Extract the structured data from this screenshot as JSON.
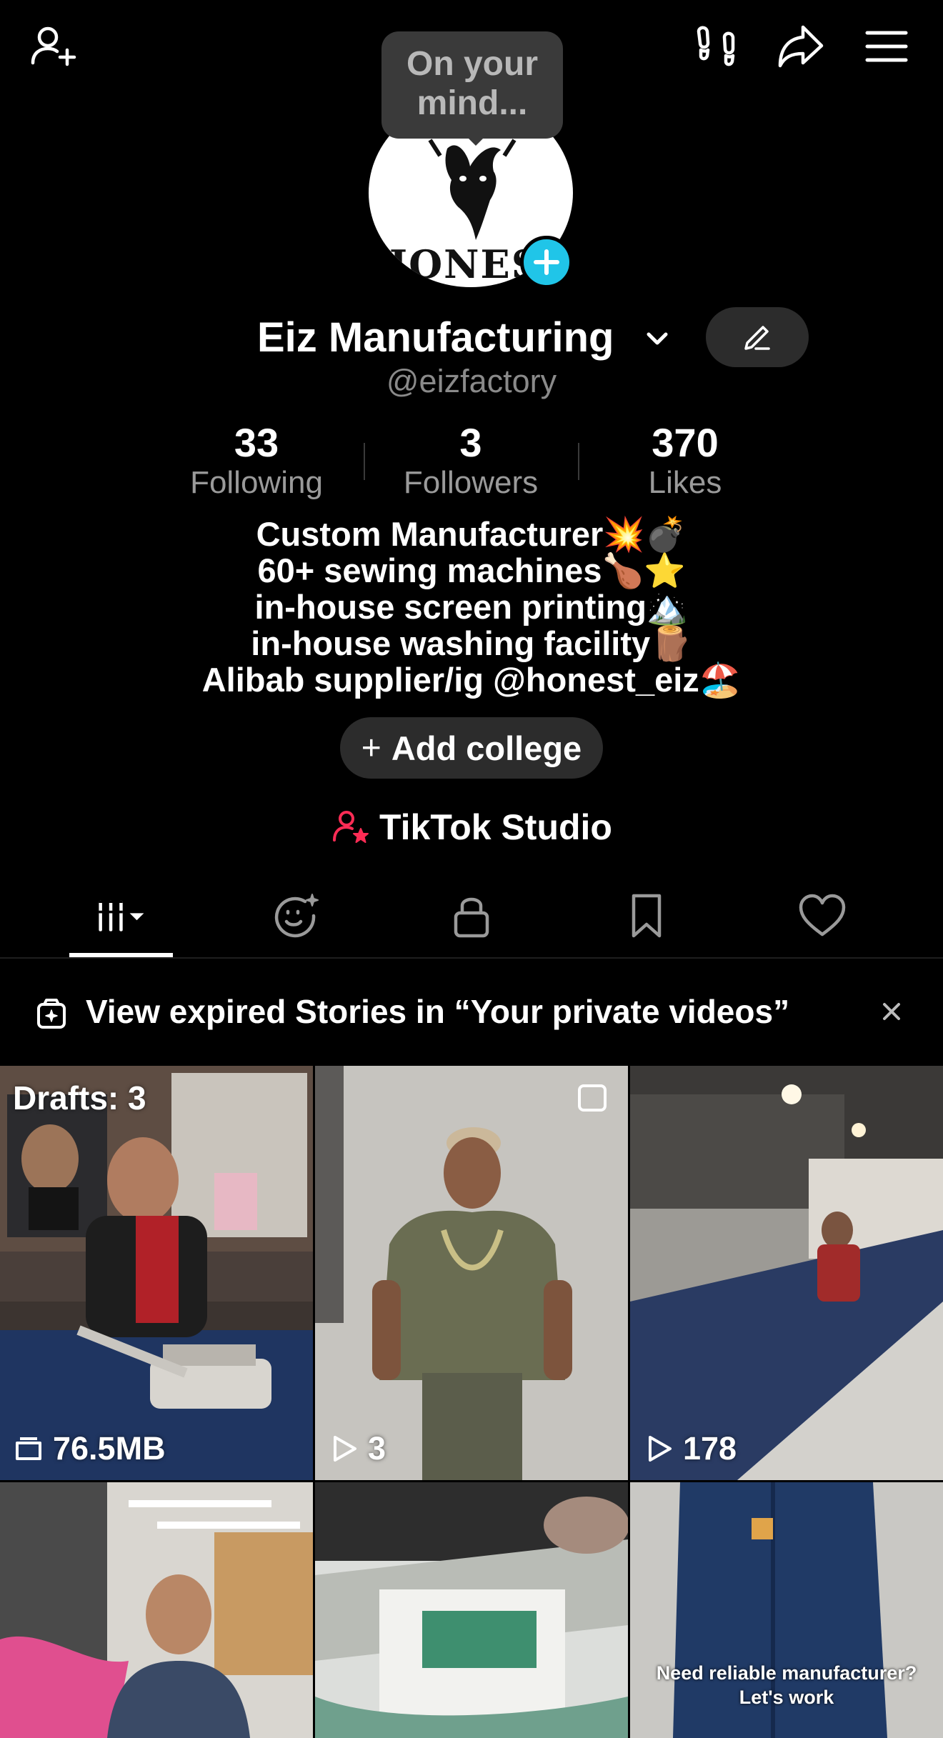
{
  "top_bar": {
    "icons": [
      "add-friend-icon",
      "footprints-icon",
      "share-icon",
      "menu-icon"
    ]
  },
  "tooltip": {
    "text_line1": "On your",
    "text_line2": "mind..."
  },
  "profile": {
    "avatar_text": "HONEST",
    "name": "Eiz Manufacturing",
    "handle": "@eizfactory"
  },
  "stats": [
    {
      "value": "33",
      "label": "Following"
    },
    {
      "value": "3",
      "label": "Followers"
    },
    {
      "value": "370",
      "label": "Likes"
    }
  ],
  "bio": {
    "lines": [
      "Custom Manufacturer💥💣",
      "60+ sewing machines🍗⭐",
      "in-house screen printing🏔️",
      "in-house washing facility🪵",
      "Alibab supplier/ig @honest_eiz🏖️"
    ]
  },
  "buttons": {
    "add_college": "Add college",
    "tiktok_studio": "TikTok Studio"
  },
  "tabs": [
    "videos-tab",
    "reposts-tab",
    "private-tab",
    "saved-tab",
    "liked-tab"
  ],
  "banner": {
    "text": "View expired Stories in “Your private videos”"
  },
  "grid": {
    "items": [
      {
        "label": "Drafts: 3",
        "footer": "76.5MB"
      },
      {
        "footer": "3"
      },
      {
        "footer": "178"
      },
      {},
      {},
      {
        "caption_line1": "Need reliable manufacturer?",
        "caption_line2": "Let's work"
      }
    ]
  },
  "colors": {
    "background": "#000000",
    "accent_cyan": "#20c5e8",
    "studio_pink": "#fe2c55",
    "muted_text": "#8a8a8a",
    "button_bg": "#2c2c2c"
  }
}
